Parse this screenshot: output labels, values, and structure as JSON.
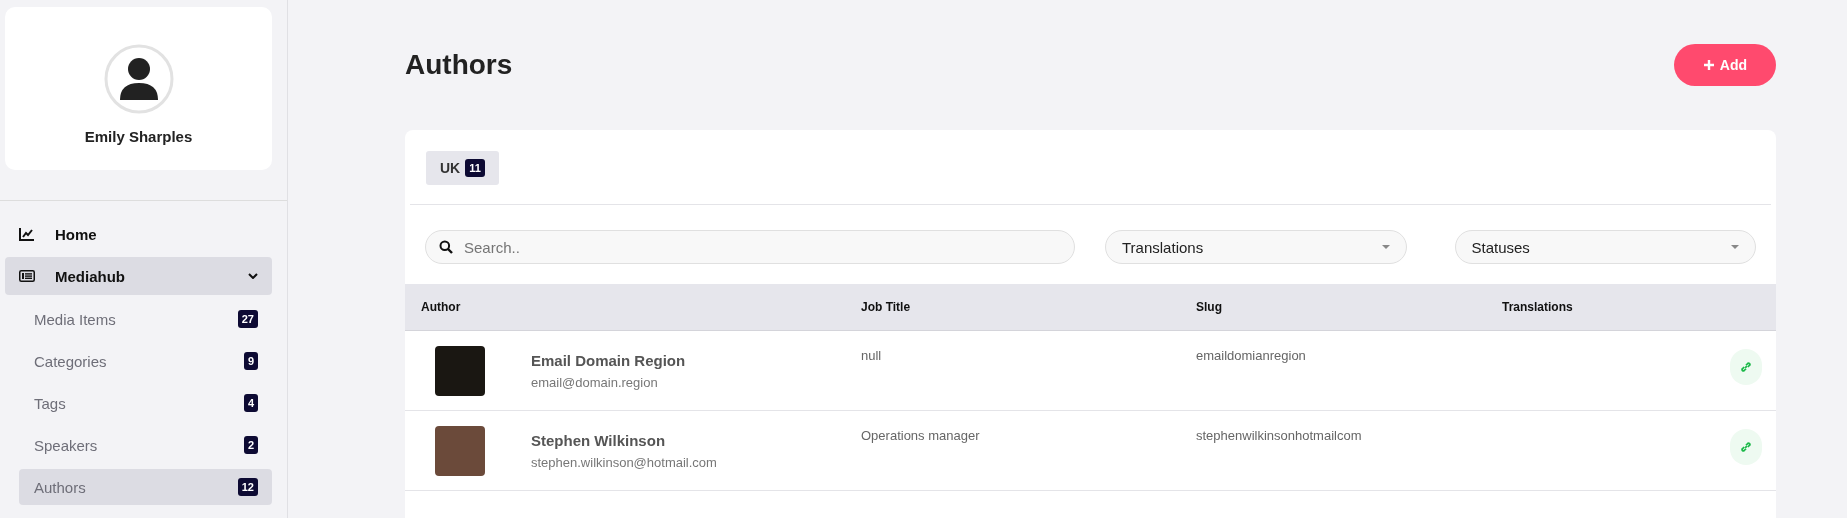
{
  "profile": {
    "name": "Emily Sharples"
  },
  "nav": [
    {
      "label": "Home",
      "kind": "link",
      "selected": false
    },
    {
      "label": "Mediahub",
      "kind": "group",
      "selected": true,
      "expanded": true,
      "children": [
        {
          "label": "Media Items",
          "count": "27",
          "selected": false
        },
        {
          "label": "Categories",
          "count": "9",
          "selected": false
        },
        {
          "label": "Tags",
          "count": "4",
          "selected": false
        },
        {
          "label": "Speakers",
          "count": "2",
          "selected": false
        },
        {
          "label": "Authors",
          "count": "12",
          "selected": true
        }
      ]
    }
  ],
  "page": {
    "title": "Authors",
    "add_button": "Add"
  },
  "tabs": [
    {
      "label": "UK",
      "count": "11",
      "selected": true
    }
  ],
  "search": {
    "placeholder": "Search.."
  },
  "filters": [
    {
      "label": "Translations"
    },
    {
      "label": "Statuses"
    }
  ],
  "table": {
    "columns": [
      "Author",
      "Job Title",
      "Slug",
      "Translations"
    ],
    "rows": [
      {
        "name": "Email Domain Region",
        "email": "email@domain.region",
        "job_title": "null",
        "slug": "emaildomianregion"
      },
      {
        "name": "Stephen Wilkinson",
        "email": "stephen.wilkinson@hotmail.com",
        "job_title": "Operations manager",
        "slug": "stephenwilkinsonhotmailcom"
      }
    ]
  }
}
